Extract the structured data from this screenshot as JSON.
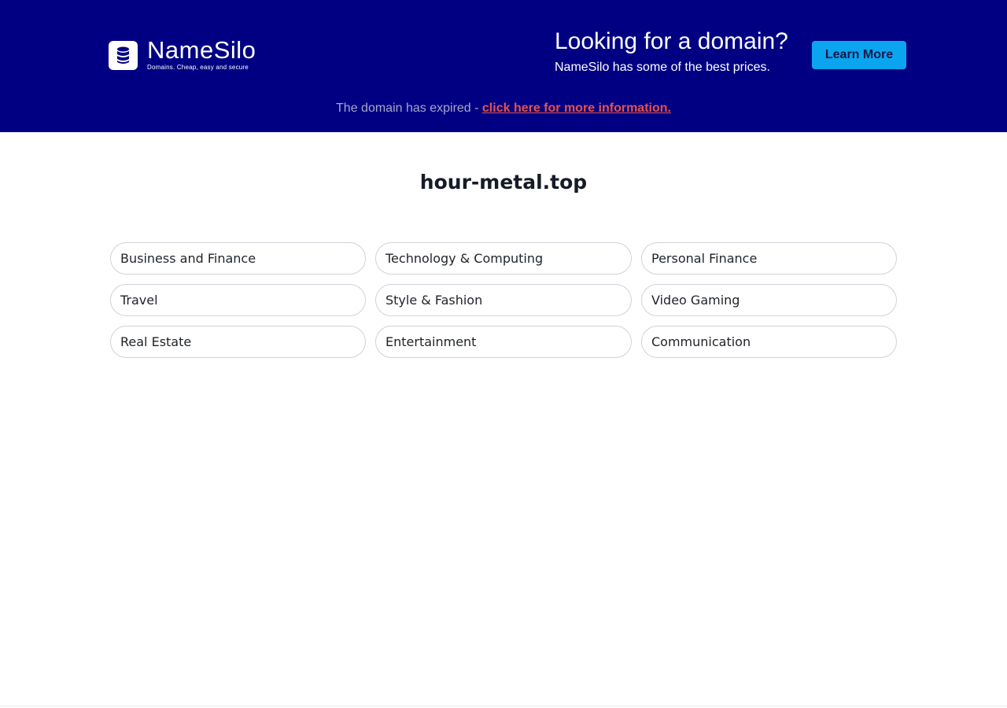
{
  "banner": {
    "logo": {
      "name": "NameSilo",
      "tagline": "Domains. Cheap, easy and secure"
    },
    "promo": {
      "title": "Looking for a domain?",
      "subtitle": "NameSilo has some of the best prices."
    },
    "learn_more_label": "Learn More",
    "expired": {
      "text": "The domain has expired - ",
      "link_label": "click here for more information."
    }
  },
  "main": {
    "domain_name": "hour-metal.top",
    "categories": [
      "Business and Finance",
      "Technology & Computing",
      "Personal Finance",
      "Travel",
      "Style & Fashion",
      "Video Gaming",
      "Real Estate",
      "Entertainment",
      "Communication"
    ]
  },
  "colors": {
    "banner_bg": "#010083",
    "button_bg": "#0aa4ef",
    "link": "#e5534b"
  },
  "icons": {
    "logo_mark": "database-stack-icon"
  }
}
